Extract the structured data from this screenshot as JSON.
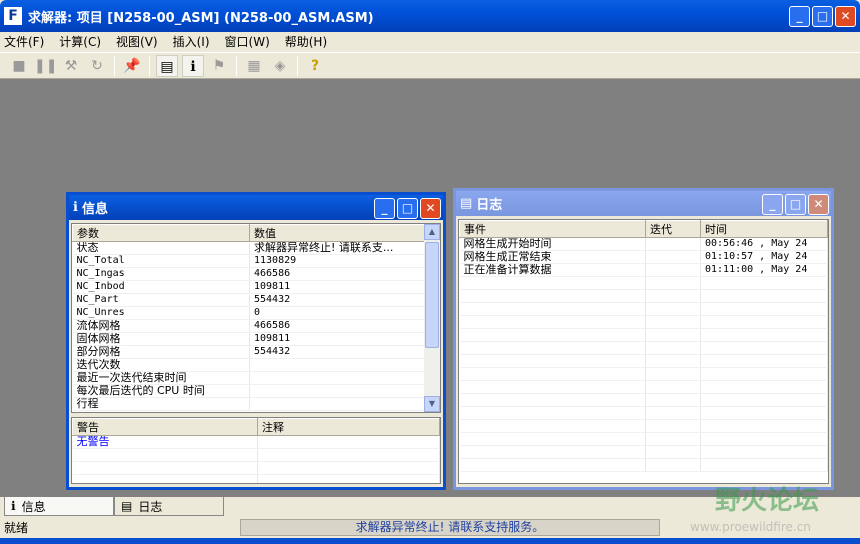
{
  "app": {
    "icon_letter": "F",
    "title": "求解器: 项目 [N258-00_ASM] (N258-00_ASM.ASM)"
  },
  "menu": [
    "文件(F)",
    "计算(C)",
    "视图(V)",
    "插入(I)",
    "窗口(W)",
    "帮助(H)"
  ],
  "toolbar": [
    {
      "icon": "stop-icon",
      "glyph": "■",
      "enabled": false
    },
    {
      "icon": "pause-icon",
      "glyph": "❚❚",
      "enabled": false
    },
    {
      "icon": "hammer-icon",
      "glyph": "⚒",
      "enabled": false
    },
    {
      "icon": "refresh-icon",
      "glyph": "↻",
      "enabled": false
    },
    {
      "icon": "pin-icon",
      "glyph": "📌",
      "enabled": true
    },
    {
      "icon": "log-icon",
      "glyph": "▤",
      "enabled": true
    },
    {
      "icon": "info-icon",
      "glyph": "ℹ",
      "enabled": true
    },
    {
      "icon": "flag-icon",
      "glyph": "⚑",
      "enabled": false
    },
    {
      "icon": "grid-icon",
      "glyph": "▦",
      "enabled": false
    },
    {
      "icon": "probe-icon",
      "glyph": "◈",
      "enabled": false
    },
    {
      "icon": "help-icon",
      "glyph": "?",
      "enabled": true
    }
  ],
  "info": {
    "title": "信息",
    "headers": [
      "参数",
      "数值"
    ],
    "rows": [
      [
        "状态",
        "求解器异常终止! 请联系支..."
      ],
      [
        "NC_Total",
        "1130829"
      ],
      [
        "NC_Ingas",
        "466586"
      ],
      [
        "NC_Inbod",
        "109811"
      ],
      [
        "NC_Part",
        "554432"
      ],
      [
        "NC_Unres",
        "0"
      ],
      [
        "流体网格",
        "466586"
      ],
      [
        "固体网格",
        "109811"
      ],
      [
        "部分网格",
        "554432"
      ],
      [
        "迭代次数",
        ""
      ],
      [
        "最近一次迭代结束时间",
        ""
      ],
      [
        "每次最后迭代的 CPU 时间",
        ""
      ],
      [
        "行程",
        ""
      ]
    ],
    "warn_headers": [
      "警告",
      "注释"
    ],
    "warnings": [
      [
        "无警告",
        ""
      ]
    ]
  },
  "log": {
    "title": "日志",
    "headers": [
      "事件",
      "迭代",
      "时间"
    ],
    "rows": [
      [
        "网格生成开始时间",
        "",
        "00:56:46 , May 24"
      ],
      [
        "网格生成正常结束",
        "",
        "01:10:57 , May 24"
      ],
      [
        "正在准备计算数据",
        "",
        "01:11:00 , May 24"
      ]
    ]
  },
  "tabs": [
    "信息",
    "日志"
  ],
  "status": {
    "left": "就绪",
    "message": "求解器异常终止! 请联系支持服务。"
  },
  "watermark": {
    "name": "野火论坛",
    "url": "www.proewildfire.cn"
  },
  "colors": {
    "titlebar": "#0a5fe0",
    "mdi": "#808080",
    "warning_text": "#0000ff"
  }
}
